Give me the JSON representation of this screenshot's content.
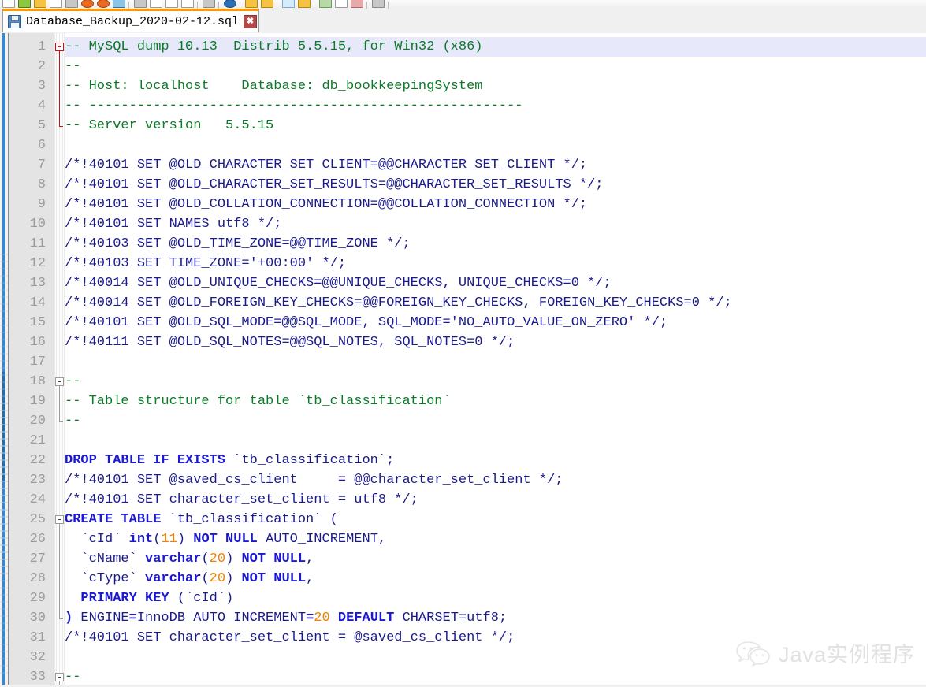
{
  "window": {
    "tab": {
      "title": "Database_Backup_2020-02-12.sql",
      "save_icon": "floppy-disk-icon",
      "close_label": "✖"
    }
  },
  "toolbar": {
    "buttons": [
      {
        "name": "new-file-button",
        "style": "w"
      },
      {
        "name": "open-file-button",
        "style": "g"
      },
      {
        "name": "save-file-button",
        "style": "y"
      },
      {
        "name": "save-all-button",
        "style": "w"
      },
      {
        "name": "print-button",
        "style": "gr"
      },
      {
        "name": "close-file-button",
        "style": "o"
      },
      {
        "name": "close-all-button",
        "style": "o"
      },
      {
        "name": "cut-button",
        "style": "b"
      },
      {
        "name": "sep1",
        "style": "sep"
      },
      {
        "name": "copy-button",
        "style": "gr"
      },
      {
        "name": "paste-button",
        "style": "w"
      },
      {
        "name": "undo-button",
        "style": "w"
      },
      {
        "name": "redo-button",
        "style": "w"
      },
      {
        "name": "sep2",
        "style": "sep"
      },
      {
        "name": "find-button",
        "style": "gr"
      },
      {
        "name": "sep3",
        "style": "sep"
      },
      {
        "name": "zoom-in-button",
        "style": "bl"
      },
      {
        "name": "sep4",
        "style": "sep"
      },
      {
        "name": "word-wrap-button",
        "style": "y"
      },
      {
        "name": "show-symbol-button",
        "style": "y"
      },
      {
        "name": "sep5",
        "style": "sep"
      },
      {
        "name": "document-map-button",
        "style": "lb"
      },
      {
        "name": "function-list-button",
        "style": "y"
      },
      {
        "name": "sep6",
        "style": "sep"
      },
      {
        "name": "run-button",
        "style": "gn"
      },
      {
        "name": "macro-record-button",
        "style": "w"
      },
      {
        "name": "macro-stop-button",
        "style": "r"
      },
      {
        "name": "sep7",
        "style": "sep"
      },
      {
        "name": "plugin-button",
        "style": "gr"
      },
      {
        "name": "sep8",
        "style": "sep"
      }
    ]
  },
  "editor": {
    "current_line": 1,
    "first_visible_line": 1,
    "colors": {
      "comment": "#0a7a27",
      "keyword": "#1b18d4",
      "identifier": "#1a1a8c",
      "number": "#f08000",
      "gutter_bg": "#e4e4e4",
      "current_line_bg": "#e8e8fb",
      "tab_accent": "#ff9900"
    },
    "lines": [
      {
        "n": 1,
        "fold": "start-red",
        "tokens": [
          {
            "t": "-- MySQL dump 10.13  Distrib 5.5.15, for Win32 (x86)",
            "c": "cm"
          }
        ]
      },
      {
        "n": 2,
        "fold": "bar-red",
        "tokens": [
          {
            "t": "--",
            "c": "cm"
          }
        ]
      },
      {
        "n": 3,
        "fold": "bar-red",
        "tokens": [
          {
            "t": "-- Host: localhost    Database: db_bookkeepingSystem",
            "c": "cm"
          }
        ]
      },
      {
        "n": 4,
        "fold": "bar-red",
        "tokens": [
          {
            "t": "-- ------------------------------------------------------",
            "c": "cm"
          }
        ]
      },
      {
        "n": 5,
        "fold": "end-red",
        "tokens": [
          {
            "t": "-- Server version   5.5.15",
            "c": "cm"
          }
        ]
      },
      {
        "n": 6,
        "fold": "",
        "tokens": []
      },
      {
        "n": 7,
        "fold": "",
        "tokens": [
          {
            "t": "/*!40101 SET @OLD_CHARACTER_SET_CLIENT=@@CHARACTER_SET_CLIENT */;",
            "c": "id"
          }
        ]
      },
      {
        "n": 8,
        "fold": "",
        "tokens": [
          {
            "t": "/*!40101 SET @OLD_CHARACTER_SET_RESULTS=@@CHARACTER_SET_RESULTS */;",
            "c": "id"
          }
        ]
      },
      {
        "n": 9,
        "fold": "",
        "tokens": [
          {
            "t": "/*!40101 SET @OLD_COLLATION_CONNECTION=@@COLLATION_CONNECTION */;",
            "c": "id"
          }
        ]
      },
      {
        "n": 10,
        "fold": "",
        "tokens": [
          {
            "t": "/*!40101 SET NAMES utf8 */;",
            "c": "id"
          }
        ]
      },
      {
        "n": 11,
        "fold": "",
        "tokens": [
          {
            "t": "/*!40103 SET @OLD_TIME_ZONE=@@TIME_ZONE */;",
            "c": "id"
          }
        ]
      },
      {
        "n": 12,
        "fold": "",
        "tokens": [
          {
            "t": "/*!40103 SET TIME_ZONE='+00:00' */;",
            "c": "id"
          }
        ]
      },
      {
        "n": 13,
        "fold": "",
        "tokens": [
          {
            "t": "/*!40014 SET @OLD_UNIQUE_CHECKS=@@UNIQUE_CHECKS, UNIQUE_CHECKS=0 */;",
            "c": "id"
          }
        ]
      },
      {
        "n": 14,
        "fold": "",
        "tokens": [
          {
            "t": "/*!40014 SET @OLD_FOREIGN_KEY_CHECKS=@@FOREIGN_KEY_CHECKS, FOREIGN_KEY_CHECKS=0 */;",
            "c": "id"
          }
        ]
      },
      {
        "n": 15,
        "fold": "",
        "tokens": [
          {
            "t": "/*!40101 SET @OLD_SQL_MODE=@@SQL_MODE, SQL_MODE='NO_AUTO_VALUE_ON_ZERO' */;",
            "c": "id"
          }
        ]
      },
      {
        "n": 16,
        "fold": "",
        "tokens": [
          {
            "t": "/*!40111 SET @OLD_SQL_NOTES=@@SQL_NOTES, SQL_NOTES=0 */;",
            "c": "id"
          }
        ]
      },
      {
        "n": 17,
        "fold": "",
        "tokens": []
      },
      {
        "n": 18,
        "fold": "start",
        "tokens": [
          {
            "t": "--",
            "c": "cm"
          }
        ]
      },
      {
        "n": 19,
        "fold": "bar",
        "tokens": [
          {
            "t": "-- Table structure for table `tb_classification`",
            "c": "cm"
          }
        ]
      },
      {
        "n": 20,
        "fold": "end",
        "tokens": [
          {
            "t": "--",
            "c": "cm"
          }
        ]
      },
      {
        "n": 21,
        "fold": "",
        "tokens": []
      },
      {
        "n": 22,
        "fold": "",
        "tokens": [
          {
            "t": "DROP TABLE IF EXISTS",
            "c": "kw"
          },
          {
            "t": " `tb_classification`;",
            "c": "id"
          }
        ]
      },
      {
        "n": 23,
        "fold": "",
        "tokens": [
          {
            "t": "/*!40101 SET @saved_cs_client     = @@character_set_client */;",
            "c": "id"
          }
        ]
      },
      {
        "n": 24,
        "fold": "",
        "tokens": [
          {
            "t": "/*!40101 SET character_set_client = utf8 */;",
            "c": "id"
          }
        ]
      },
      {
        "n": 25,
        "fold": "start",
        "tokens": [
          {
            "t": "CREATE TABLE",
            "c": "kw"
          },
          {
            "t": " `tb_classification` (",
            "c": "id"
          }
        ]
      },
      {
        "n": 26,
        "fold": "bar",
        "tokens": [
          {
            "t": "  `cId` ",
            "c": "id"
          },
          {
            "t": "int",
            "c": "kw"
          },
          {
            "t": "(",
            "c": "id"
          },
          {
            "t": "11",
            "c": "num"
          },
          {
            "t": ") ",
            "c": "id"
          },
          {
            "t": "NOT NULL",
            "c": "kw"
          },
          {
            "t": " AUTO_INCREMENT,",
            "c": "id"
          }
        ]
      },
      {
        "n": 27,
        "fold": "bar",
        "tokens": [
          {
            "t": "  `cName` ",
            "c": "id"
          },
          {
            "t": "varchar",
            "c": "kw"
          },
          {
            "t": "(",
            "c": "id"
          },
          {
            "t": "20",
            "c": "num"
          },
          {
            "t": ") ",
            "c": "id"
          },
          {
            "t": "NOT NULL",
            "c": "kw"
          },
          {
            "t": ",",
            "c": "id"
          }
        ]
      },
      {
        "n": 28,
        "fold": "bar",
        "tokens": [
          {
            "t": "  `cType` ",
            "c": "id"
          },
          {
            "t": "varchar",
            "c": "kw"
          },
          {
            "t": "(",
            "c": "id"
          },
          {
            "t": "20",
            "c": "num"
          },
          {
            "t": ") ",
            "c": "id"
          },
          {
            "t": "NOT NULL",
            "c": "kw"
          },
          {
            "t": ",",
            "c": "id"
          }
        ]
      },
      {
        "n": 29,
        "fold": "bar",
        "tokens": [
          {
            "t": "  ",
            "c": "id"
          },
          {
            "t": "PRIMARY KEY",
            "c": "kw"
          },
          {
            "t": " (`cId`)",
            "c": "id"
          }
        ]
      },
      {
        "n": 30,
        "fold": "end",
        "tokens": [
          {
            "t": ")",
            "c": "kw"
          },
          {
            "t": " ENGINE",
            "c": "id"
          },
          {
            "t": "=",
            "c": "kw"
          },
          {
            "t": "InnoDB AUTO_INCREMENT",
            "c": "id"
          },
          {
            "t": "=",
            "c": "kw"
          },
          {
            "t": "20",
            "c": "num"
          },
          {
            "t": " ",
            "c": "id"
          },
          {
            "t": "DEFAULT",
            "c": "kw"
          },
          {
            "t": " CHARSET=utf8;",
            "c": "id"
          }
        ]
      },
      {
        "n": 31,
        "fold": "",
        "tokens": [
          {
            "t": "/*!40101 SET character_set_client = @saved_cs_client */;",
            "c": "id"
          }
        ]
      },
      {
        "n": 32,
        "fold": "",
        "tokens": []
      },
      {
        "n": 33,
        "fold": "start",
        "tokens": [
          {
            "t": "--",
            "c": "cm"
          }
        ]
      }
    ]
  },
  "watermark": {
    "text": "Java实例程序",
    "icon": "wechat-logo-icon"
  }
}
